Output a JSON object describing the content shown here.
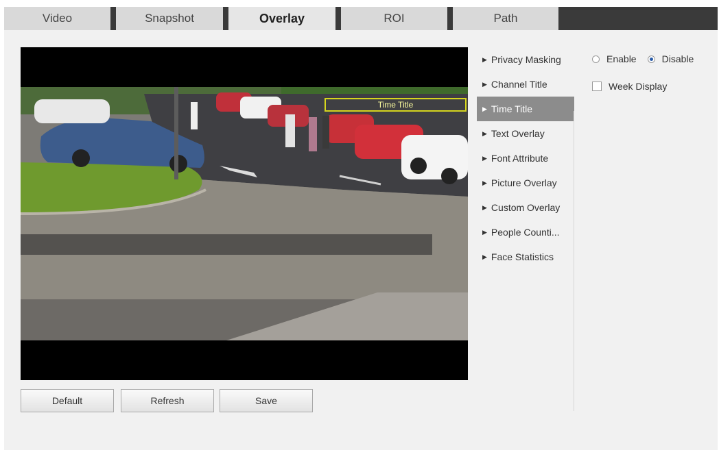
{
  "tabs": [
    {
      "label": "Video"
    },
    {
      "label": "Snapshot"
    },
    {
      "label": "Overlay",
      "active": true
    },
    {
      "label": "ROI"
    },
    {
      "label": "Path"
    }
  ],
  "video": {
    "osd_title": "Time Title"
  },
  "menu": {
    "items": [
      {
        "label": "Privacy Masking"
      },
      {
        "label": "Channel Title"
      },
      {
        "label": "Time Title",
        "active": true
      },
      {
        "label": "Text Overlay"
      },
      {
        "label": "Font Attribute"
      },
      {
        "label": "Picture Overlay"
      },
      {
        "label": "Custom Overlay"
      },
      {
        "label": "People Counti..."
      },
      {
        "label": "Face Statistics"
      }
    ]
  },
  "options": {
    "enable_label": "Enable",
    "disable_label": "Disable",
    "selected": "Disable",
    "week_display_label": "Week Display",
    "week_display_checked": false
  },
  "buttons": {
    "default_label": "Default",
    "refresh_label": "Refresh",
    "save_label": "Save"
  },
  "colors": {
    "tab_bar": "#3a3a3a",
    "active_menu": "#8c8c8c",
    "osd_box": "#d6d61e",
    "panel_bg": "#f1f1f1"
  },
  "icons": {
    "menu_arrow": "caret-right-icon"
  }
}
